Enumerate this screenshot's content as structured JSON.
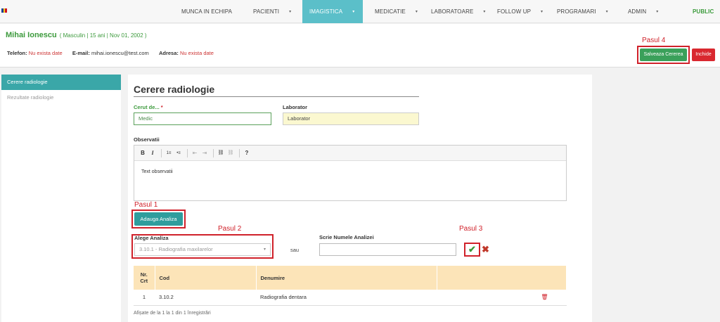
{
  "nav": {
    "items": [
      {
        "label": "MUNCA IN ECHIPA",
        "caret": false
      },
      {
        "label": "PACIENTI",
        "caret": true
      },
      {
        "label": "IMAGISTICA",
        "caret": true
      },
      {
        "label": "MEDICATIE",
        "caret": true
      },
      {
        "label": "LABORATOARE",
        "caret": true
      },
      {
        "label": "FOLLOW UP",
        "caret": true
      },
      {
        "label": "PROGRAMARI",
        "caret": true
      },
      {
        "label": "ADMIN",
        "caret": true
      },
      {
        "label": "PUBLIC",
        "caret": false
      }
    ],
    "active_index": 2,
    "caret_glyph": "▾",
    "colors": {
      "active": "#5bbfc9",
      "public": "#3a9a3a"
    }
  },
  "patient": {
    "name": "Mihai Ionescu",
    "meta": "( Masculin | 15 ani | Nov 01, 2002 )",
    "phone_label": "Telefon:",
    "phone_value": "Nu exista date",
    "email_label": "E-mail:",
    "email_value": "mihai.ionescu@test.com",
    "address_label": "Adresa:",
    "address_value": "Nu exista date"
  },
  "actions": {
    "save_label": "Salveaza Cererea",
    "close_label": "Inchide"
  },
  "annotations": {
    "step1": "Pasul 1",
    "step2": "Pasul 2",
    "step3": "Pasul 3",
    "step4": "Pasul 4",
    "color": "#d0212a"
  },
  "sidebar": {
    "items": [
      {
        "label": "Cerere radiologie",
        "active": true
      },
      {
        "label": "Rezultate radiologie",
        "active": false
      }
    ]
  },
  "form": {
    "title": "Cerere radiologie",
    "requested_by_label": "Cerut de...",
    "requested_by_required": "*",
    "requested_by_value": "Medic",
    "laboratory_label": "Laborator",
    "laboratory_value": "Laborator",
    "observations_label": "Observatii",
    "observations_text": "Text observatii",
    "toolbar": [
      "B",
      "I",
      "1≡",
      "•≡",
      "⇤",
      "⇥",
      "⛓",
      "⛓",
      "?"
    ],
    "add_analysis_label": "Adauga Analiza",
    "choose_analysis_label": "Alege Analiza",
    "choose_analysis_value": "3.10.1 - Radiografia maxilarelor",
    "or_label": "sau",
    "write_analysis_label": "Scrie Numele Analizei",
    "write_analysis_value": "",
    "confirm_icon": "✔",
    "cancel_icon": "✖"
  },
  "table": {
    "headers": [
      "Nr. Crt",
      "Cod",
      "Denumire",
      ""
    ],
    "rows": [
      {
        "nr": "1",
        "cod": "3.10.2",
        "denumire": "Radiografia dentara"
      }
    ],
    "delete_icon": "🗑",
    "footer": "Afișate de la 1 la 1 din 1 înregistrări",
    "header_color": "#fce4b8"
  }
}
